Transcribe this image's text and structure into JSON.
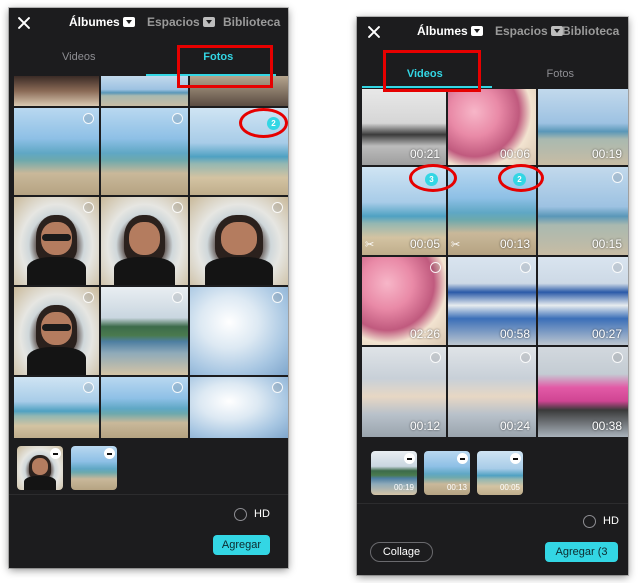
{
  "colors": {
    "accent": "#33d6e4",
    "annotation": "#e60000",
    "background": "#1c1c1e"
  },
  "left": {
    "top_tabs": [
      {
        "label": "Álbumes",
        "active": true,
        "dropdown": true
      },
      {
        "label": "Espacios",
        "active": false,
        "dropdown": true
      },
      {
        "label": "Biblioteca",
        "active": false,
        "dropdown": false
      }
    ],
    "subtabs": [
      "Videos",
      "Fotos"
    ],
    "active_subtab": "Fotos",
    "selected_badge": "2",
    "hd_label": "HD",
    "add_button": "Agregar"
  },
  "right": {
    "top_tabs": [
      {
        "label": "Álbumes",
        "active": true,
        "dropdown": true
      },
      {
        "label": "Espacios",
        "active": false,
        "dropdown": true
      },
      {
        "label": "Biblioteca",
        "active": false,
        "dropdown": false
      }
    ],
    "subtabs": [
      "Videos",
      "Fotos"
    ],
    "active_subtab": "Videos",
    "durations": [
      [
        "00:21",
        "00:06",
        "00:19"
      ],
      [
        "00:05",
        "00:13",
        "00:15"
      ],
      [
        "02:26",
        "00:58",
        "00:27"
      ],
      [
        "00:12",
        "00:24",
        "00:38"
      ]
    ],
    "selected_badges": [
      "3",
      "2"
    ],
    "tray_durations": [
      "00:19",
      "00:13",
      "00:05"
    ],
    "hd_label": "HD",
    "collage_button": "Collage",
    "add_button": "Agregar (3"
  }
}
